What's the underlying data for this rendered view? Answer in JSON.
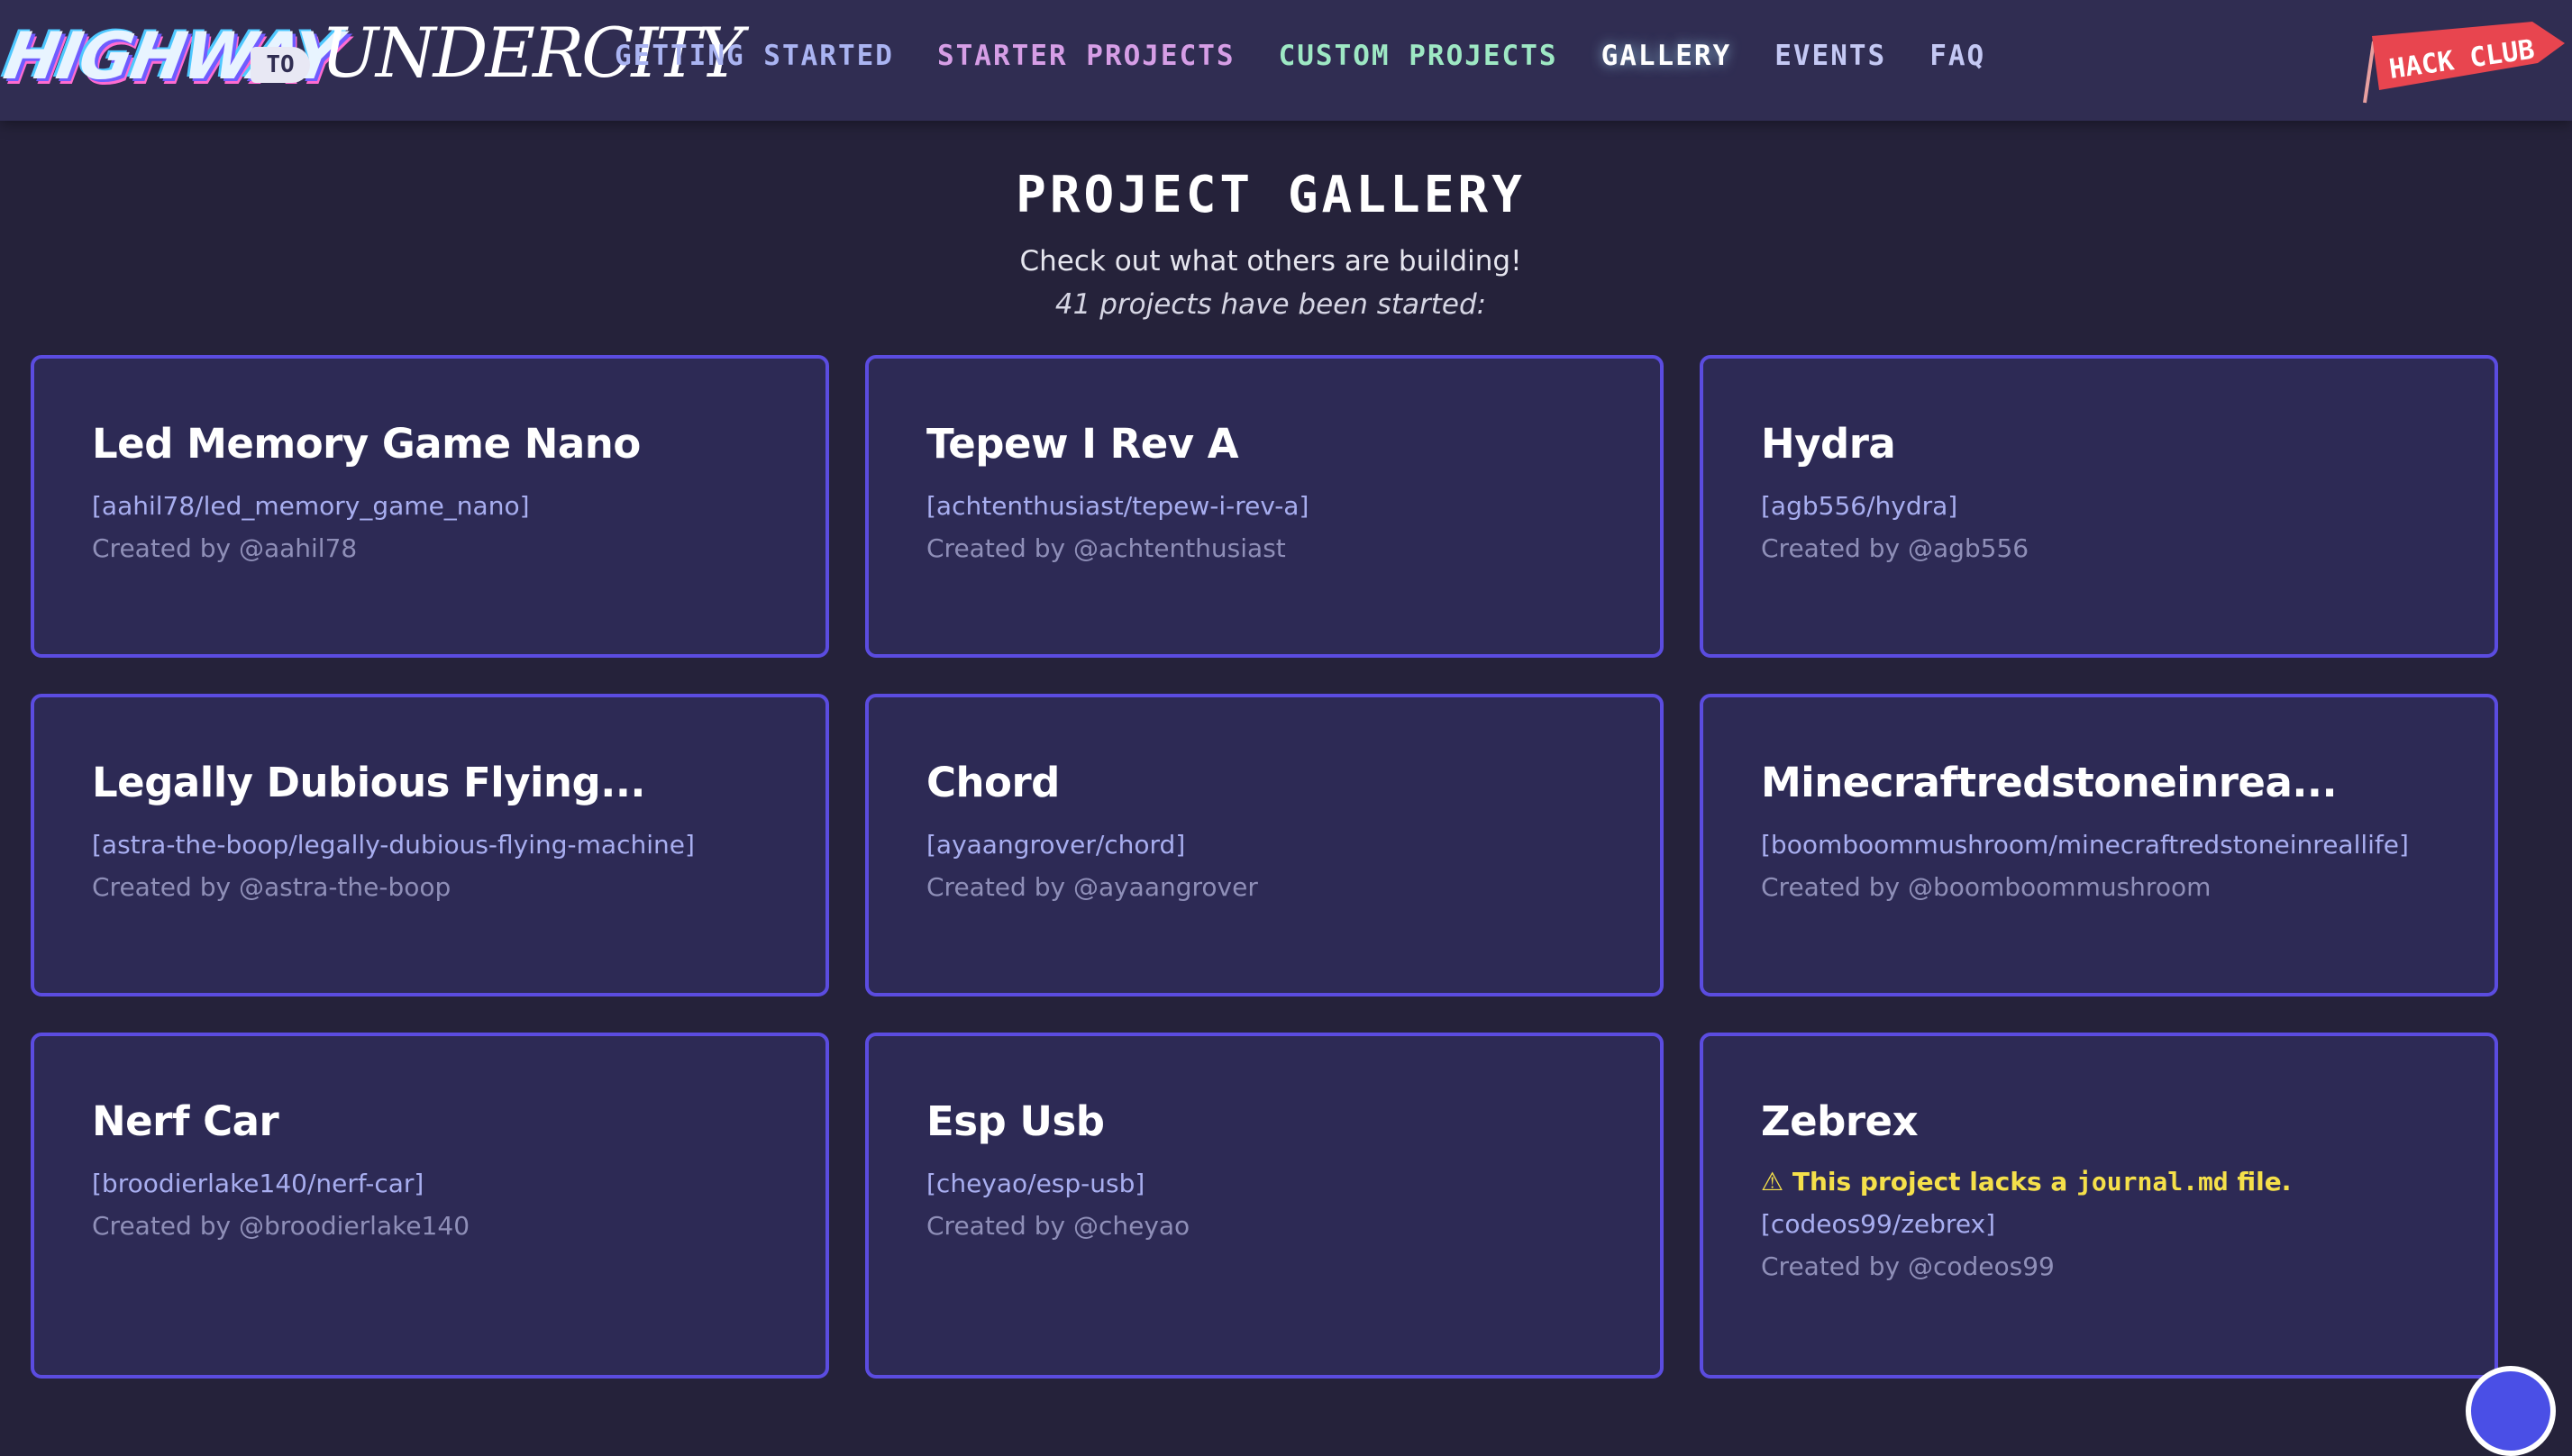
{
  "nav": {
    "logo": {
      "part1": "HIGHWAY",
      "part2": "TO",
      "part3": "UNDERCITY"
    },
    "links": [
      {
        "label": "GETTING STARTED",
        "color": "#aab4f2"
      },
      {
        "label": "STARTER PROJECTS",
        "color": "#d69ee6"
      },
      {
        "label": "CUSTOM PROJECTS",
        "color": "#9ee8c4"
      },
      {
        "label": "GALLERY",
        "color": "#ffffff",
        "active": true
      },
      {
        "label": "EVENTS",
        "color": "#c4c8f4"
      },
      {
        "label": "FAQ",
        "color": "#c4c8f4"
      }
    ],
    "badge": "HACK CLUB"
  },
  "header": {
    "title": "PROJECT GALLERY",
    "subtitle": "Check out what others are building!",
    "count_text": "41 projects have been started:"
  },
  "projects": [
    {
      "title": "Led Memory Game Nano",
      "repo": "[aahil78/led_memory_game_nano]",
      "creator": "Created by @aahil78"
    },
    {
      "title": "Tepew I Rev A",
      "repo": "[achtenthusiast/tepew-i-rev-a]",
      "creator": "Created by @achtenthusiast"
    },
    {
      "title": "Hydra",
      "repo": "[agb556/hydra]",
      "creator": "Created by @agb556"
    },
    {
      "title": "Legally Dubious Flying...",
      "repo": "[astra-the-boop/legally-dubious-flying-machine]",
      "creator": "Created by @astra-the-boop"
    },
    {
      "title": "Chord",
      "repo": "[ayaangrover/chord]",
      "creator": "Created by @ayaangrover"
    },
    {
      "title": "Minecraftredstoneinrea...",
      "repo": "[boomboommushroom/minecraftredstoneinreallife]",
      "creator": "Created by @boomboommushroom"
    },
    {
      "title": "Nerf Car",
      "repo": "[broodierlake140/nerf-car]",
      "creator": "Created by @broodierlake140"
    },
    {
      "title": "Esp Usb",
      "repo": "[cheyao/esp-usb]",
      "creator": "Created by @cheyao"
    },
    {
      "title": "Zebrex",
      "warning_prefix": "⚠ This project lacks a ",
      "warning_code": "journal.md",
      "warning_suffix": " file.",
      "repo": "[codeos99/zebrex]",
      "creator": "Created by @codeos99"
    }
  ],
  "colors": {
    "background": "#25223a",
    "nav": "#302d52",
    "card": "#2d2a55",
    "card_border": "#5b4ce0",
    "warning": "#f5e04a"
  }
}
